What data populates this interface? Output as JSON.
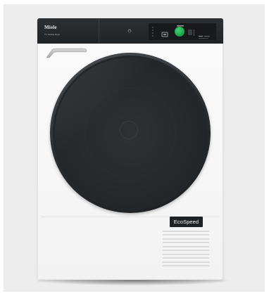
{
  "appliance": {
    "brand": "Miele",
    "model_line": "T1 Tumble Dryer",
    "badge": "EcoSpeed"
  },
  "colors": {
    "backdrop": "#ededed",
    "cabinet": "#f7f7f7",
    "panel": "#26292b",
    "door": "#2a2d30",
    "start_button": "#22b157"
  },
  "icons": {
    "power": "power-icon",
    "program": "program-icon",
    "start": "start-button"
  }
}
